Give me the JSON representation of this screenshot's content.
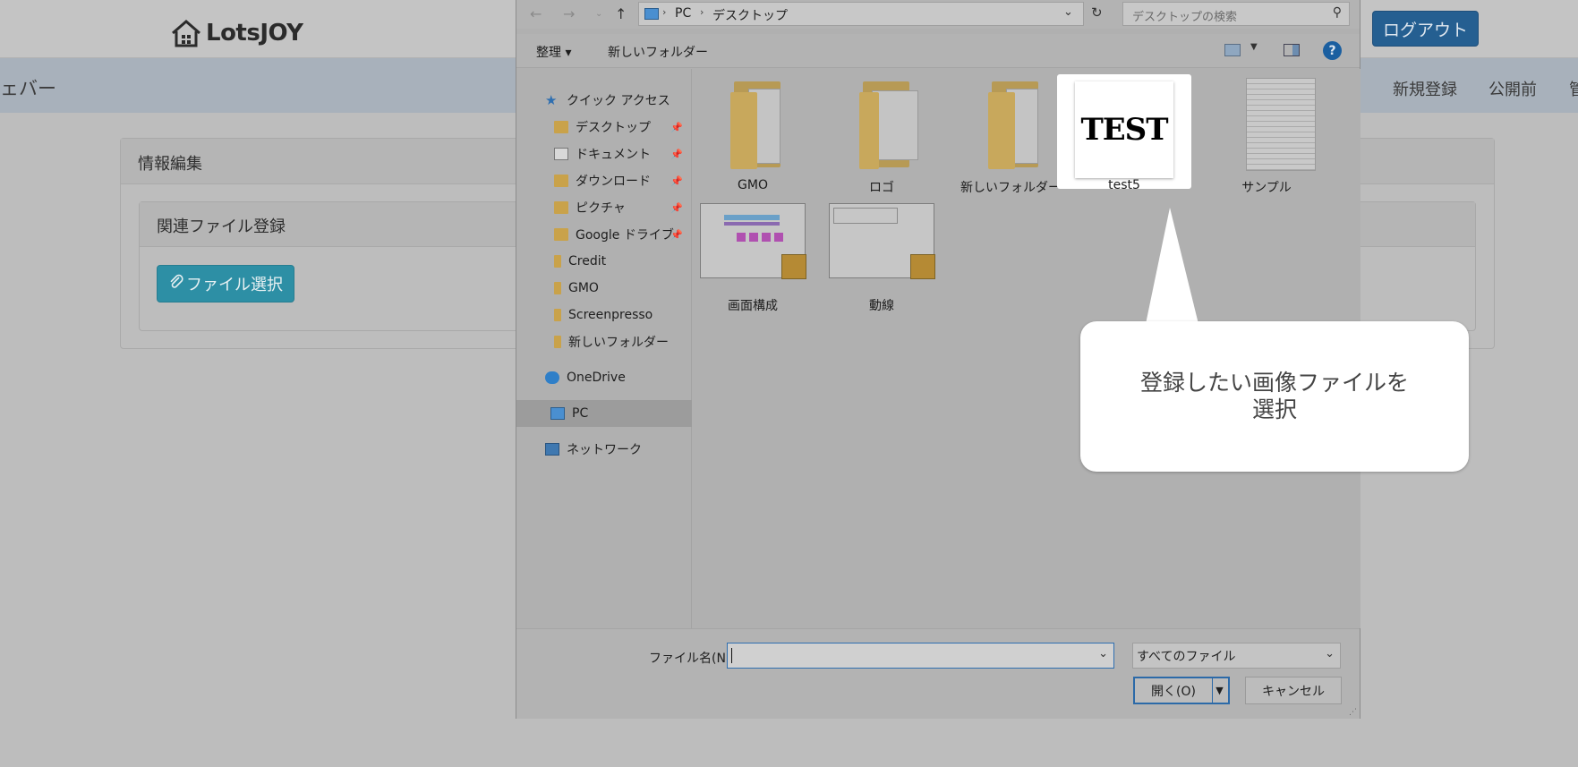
{
  "header": {
    "logo_text": "LotsJOY",
    "logout_label": "ログアウト"
  },
  "navbar": {
    "brand_fragment": "ェバー",
    "links": [
      "新規登録",
      "公開前",
      "管"
    ]
  },
  "page": {
    "panel_title": "情報編集",
    "subpanel_title": "関連ファイル登録",
    "file_button_label": "ファイル選択"
  },
  "dialog": {
    "breadcrumb": [
      "PC",
      "デスクトップ"
    ],
    "search_placeholder": "デスクトップの検索",
    "toolbar": {
      "organize_label": "整理 ▾",
      "new_folder_label": "新しいフォルダー",
      "help_label": "?"
    },
    "nav_items": [
      {
        "label": "クイック アクセス",
        "icon": "star-icon",
        "pinned": false
      },
      {
        "label": "デスクトップ",
        "icon": "folder-icon",
        "pinned": true
      },
      {
        "label": "ドキュメント",
        "icon": "document-icon",
        "pinned": true
      },
      {
        "label": "ダウンロード",
        "icon": "download-icon",
        "pinned": true
      },
      {
        "label": "ピクチャ",
        "icon": "picture-icon",
        "pinned": true
      },
      {
        "label": "Google ドライブ",
        "icon": "google-drive-icon",
        "pinned": true
      },
      {
        "label": "Credit",
        "icon": "folder-icon",
        "pinned": false
      },
      {
        "label": "GMO",
        "icon": "folder-icon",
        "pinned": false
      },
      {
        "label": "Screenpresso",
        "icon": "folder-icon",
        "pinned": false
      },
      {
        "label": "新しいフォルダー",
        "icon": "folder-icon",
        "pinned": false
      },
      {
        "label": "OneDrive",
        "icon": "onedrive-icon",
        "pinned": false
      },
      {
        "label": "PC",
        "icon": "pc-icon",
        "pinned": false,
        "selected": true
      },
      {
        "label": "ネットワーク",
        "icon": "network-icon",
        "pinned": false
      }
    ],
    "files": [
      {
        "name": "GMO",
        "kind": "folder"
      },
      {
        "name": "ロゴ",
        "kind": "folder"
      },
      {
        "name": "新しいフォルダー",
        "kind": "folder"
      },
      {
        "name": "test5",
        "kind": "image",
        "thumbnail_text": "TEST",
        "selected": true
      },
      {
        "name": "サンプル",
        "kind": "document"
      },
      {
        "name": "画面構成",
        "kind": "image"
      },
      {
        "name": "動線",
        "kind": "image"
      }
    ],
    "filename_label": "ファイル名(N):",
    "filename_value": "",
    "filter_value": "すべてのファイル",
    "open_label": "開く(O)",
    "cancel_label": "キャンセル"
  },
  "callout": {
    "text": "登録したい画像ファイルを\n選択"
  },
  "colors": {
    "logout_button": "#255f91",
    "file_button": "#2d8fa5",
    "accent_border": "#2c6aa8"
  }
}
